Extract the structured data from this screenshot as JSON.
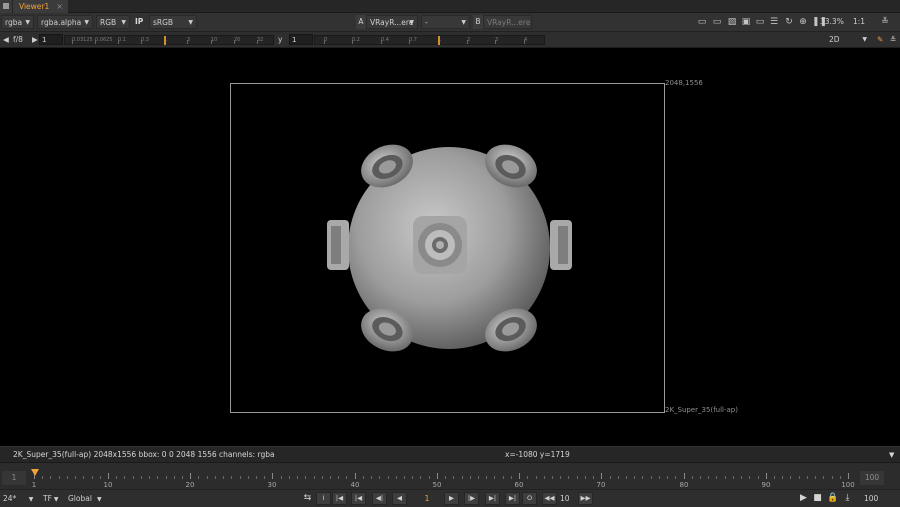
{
  "tab": {
    "title": "Viewer1",
    "close": "×"
  },
  "toolbar1": {
    "channels": "rgba",
    "alpha_channel": "rgba.alpha",
    "display_channels": "RGB",
    "ip_label": "IP",
    "colorspace": "sRGB",
    "input_a_label": "A",
    "input_a": "VRayR...ere",
    "composite_mode": "-",
    "input_b_label": "B",
    "input_b": "VRayR...ere",
    "zoom": "33.3%",
    "proxy": "1:1"
  },
  "toolbar2": {
    "fstop_label": "f/8",
    "gain_value": "1",
    "gain_ticks": [
      "0.03125",
      "0.0625",
      "0.1",
      "0.3",
      "1",
      "3",
      "10",
      "20",
      "32"
    ],
    "gamma_label": "y",
    "gamma_value": "1",
    "gamma_ticks": [
      "0",
      "0.2",
      "0.4",
      "0.7",
      "1",
      "2",
      "3",
      "4"
    ],
    "view_mode": "2D"
  },
  "viewer": {
    "format_top_right": "2048,1556",
    "format_bottom_right": "2K_Super_35(full-ap)"
  },
  "infobar": {
    "format_info": "2K_Super_35(full-ap) 2048x1556  bbox: 0 0 2048 1556 channels: rgba",
    "coords": "x=-1080 y=1719"
  },
  "timeline": {
    "in_point": "1",
    "out_point": "100",
    "labels": [
      "1",
      "10",
      "20",
      "30",
      "40",
      "50",
      "60",
      "70",
      "80",
      "90",
      "100"
    ]
  },
  "transport": {
    "fps": "24*",
    "time_mode": "TF",
    "range_mode": "Global",
    "current_frame": "1",
    "skip_increment": "10",
    "end_frame": "100"
  },
  "colors": {
    "accent": "#f0a23c",
    "panel": "#323232",
    "viewer_bg": "#000000"
  }
}
